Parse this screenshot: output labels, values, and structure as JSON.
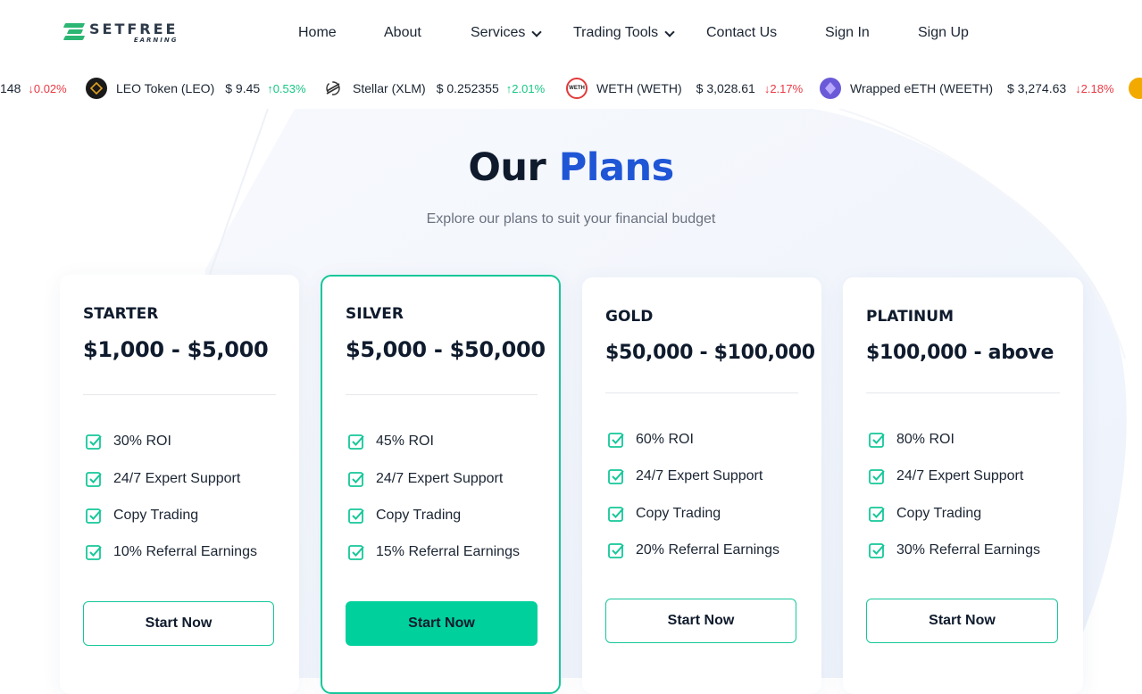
{
  "brand": {
    "name": "SETFREE",
    "sub": "EARNING"
  },
  "nav": {
    "home": "Home",
    "about": "About",
    "services": "Services",
    "trading_tools": "Trading Tools",
    "contact": "Contact Us",
    "sign_in": "Sign In",
    "sign_up": "Sign Up"
  },
  "ticker": [
    {
      "name": "",
      "price": "148",
      "change": "0.02%",
      "direction": "down"
    },
    {
      "name": "LEO Token (LEO)",
      "price": "$ 9.45",
      "change": "0.53%",
      "direction": "up",
      "icon": "leo-token-icon"
    },
    {
      "name": "Stellar (XLM)",
      "price": "$ 0.252355",
      "change": "2.01%",
      "direction": "up",
      "icon": "stellar-icon"
    },
    {
      "name": "WETH (WETH)",
      "price": "$ 3,028.61",
      "change": "2.17%",
      "direction": "down",
      "icon": "weth-icon",
      "icon_text": "WETH"
    },
    {
      "name": "Wrapped eETH (WEETH)",
      "price": "$ 3,274.63",
      "change": "2.18%",
      "direction": "down",
      "icon": "weeth-icon"
    }
  ],
  "section": {
    "title_a": "Our",
    "title_b": "Plans",
    "subtitle": "Explore our plans to suit your financial budget"
  },
  "plans": [
    {
      "name": "STARTER",
      "range": "$1,000 - $5,000",
      "features": [
        "30% ROI",
        "24/7 Expert Support",
        "Copy Trading",
        "10% Referral Earnings"
      ],
      "button": "Start Now"
    },
    {
      "name": "SILVER",
      "range": "$5,000 - $50,000",
      "features": [
        "45% ROI",
        "24/7 Expert Support",
        "Copy Trading",
        "15% Referral Earnings"
      ],
      "button": "Start Now",
      "featured": true
    },
    {
      "name": "GOLD",
      "range": "$50,000 - $100,000",
      "features": [
        "60% ROI",
        "24/7 Expert Support",
        "Copy Trading",
        "20% Referral Earnings"
      ],
      "button": "Start Now"
    },
    {
      "name": "PLATINUM",
      "range": "$100,000 - above",
      "features": [
        "80% ROI",
        "24/7 Expert Support",
        "Copy Trading",
        "30% Referral Earnings"
      ],
      "button": "Start Now"
    }
  ],
  "colors": {
    "accent": "#16c79a",
    "brand_blue": "#1f56d6",
    "up": "#16c784",
    "down": "#ea3943"
  }
}
